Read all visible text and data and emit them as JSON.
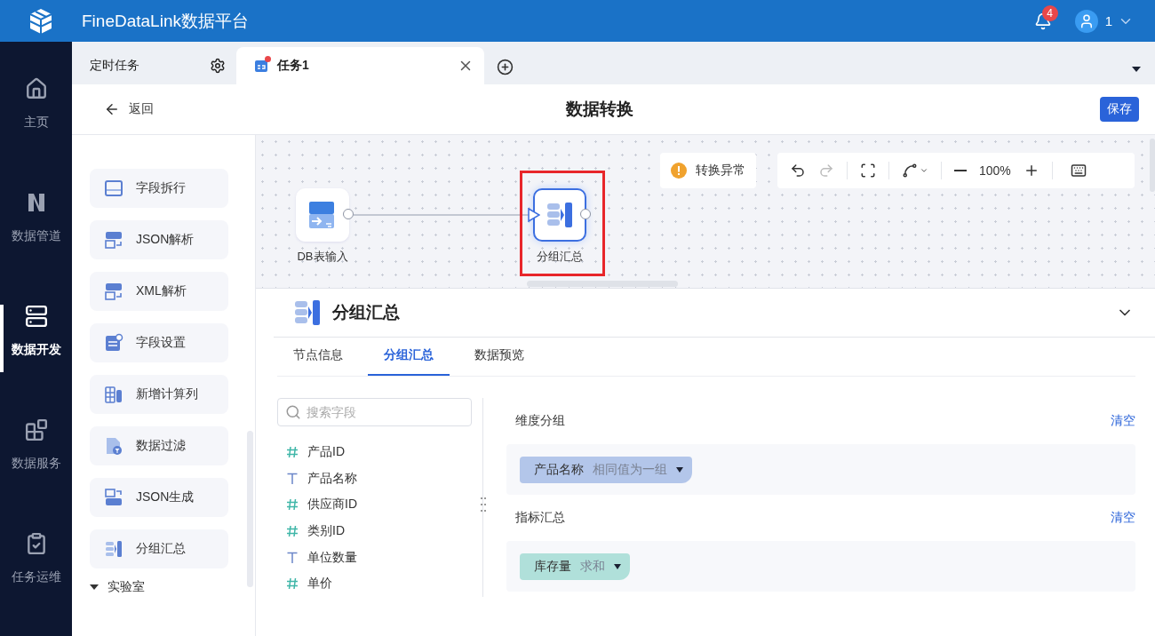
{
  "app": {
    "title": "FineDataLink数据平台",
    "notifications": "4",
    "user": "1"
  },
  "nav": [
    {
      "label": "主页",
      "kind": "home",
      "selected": false
    },
    {
      "label": "数据管道",
      "kind": "pipeline",
      "selected": false
    },
    {
      "label": "数据开发",
      "kind": "develop",
      "selected": true
    },
    {
      "label": "数据服务",
      "kind": "service",
      "selected": false
    },
    {
      "label": "任务运维",
      "kind": "ops",
      "selected": false
    }
  ],
  "tabs": [
    {
      "label": "定时任务",
      "kind": "settings",
      "selected": false
    },
    {
      "label": "任务1",
      "kind": "task",
      "selected": true
    }
  ],
  "page": {
    "back": "返回",
    "title": "数据转换",
    "save": "保存"
  },
  "palette": {
    "items": [
      {
        "label": "字段拆行",
        "kind": "rows"
      },
      {
        "label": "JSON解析",
        "kind": "json-parse"
      },
      {
        "label": "XML解析",
        "kind": "xml-parse"
      },
      {
        "label": "字段设置",
        "kind": "settings"
      },
      {
        "label": "新增计算列",
        "kind": "calc"
      },
      {
        "label": "数据过滤",
        "kind": "filter"
      },
      {
        "label": "JSON生成",
        "kind": "json-gen"
      },
      {
        "label": "分组汇总",
        "kind": "group"
      }
    ],
    "section": {
      "label": "实验室",
      "expanded": true
    }
  },
  "canvas": {
    "status": "转换异常",
    "zoom": "100%",
    "nodes": [
      {
        "label": "DB表输入",
        "kind": "db",
        "highlighted": false
      },
      {
        "label": "分组汇总",
        "kind": "group",
        "highlighted": true
      }
    ]
  },
  "detail": {
    "title": "分组汇总",
    "tabs": [
      {
        "label": "节点信息",
        "selected": false
      },
      {
        "label": "分组汇总",
        "selected": true
      },
      {
        "label": "数据预览",
        "selected": false
      }
    ],
    "search": {
      "placeholder": "搜索字段"
    },
    "fields": [
      {
        "name": "产品ID",
        "kind": "number"
      },
      {
        "name": "产品名称",
        "kind": "text"
      },
      {
        "name": "供应商ID",
        "kind": "number"
      },
      {
        "name": "类别ID",
        "kind": "number"
      },
      {
        "name": "单位数量",
        "kind": "text"
      },
      {
        "name": "单价",
        "kind": "number"
      }
    ],
    "groups": [
      {
        "title": "维度分组",
        "action": "清空",
        "chips": [
          {
            "field": "产品名称",
            "mode": "相同值为一组",
            "color": "#b3c6ea"
          }
        ]
      },
      {
        "title": "指标汇总",
        "action": "清空",
        "chips": [
          {
            "field": "库存量",
            "mode": "求和",
            "color": "#b0e0da"
          }
        ]
      }
    ]
  }
}
